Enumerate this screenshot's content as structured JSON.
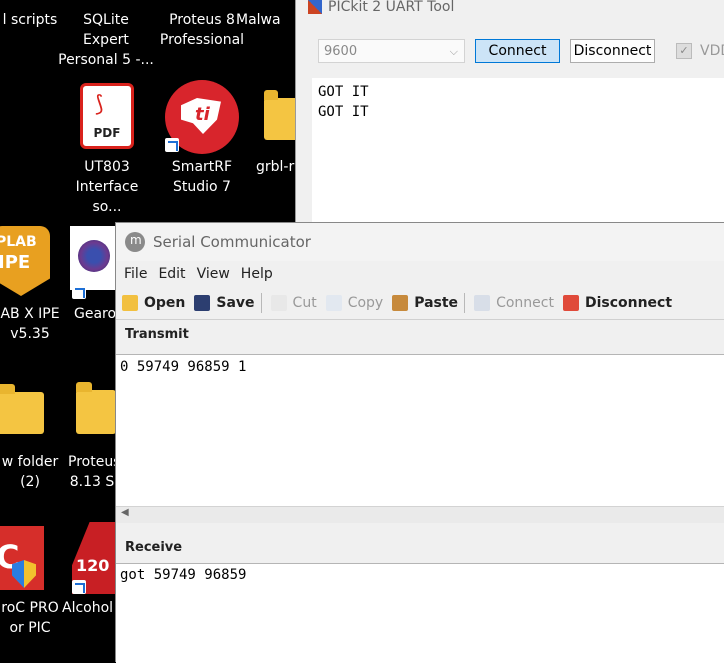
{
  "desktop": {
    "icons": [
      {
        "label": "l scripts"
      },
      {
        "label": "SQLite Expert\nPersonal 5 -..."
      },
      {
        "label": "Proteus 8\nProfessional"
      },
      {
        "label": "Malwa"
      },
      {
        "label": "UT803\nInterface so..."
      },
      {
        "label": "SmartRF\nStudio 7"
      },
      {
        "label": "grbl-r"
      },
      {
        "label": "AB X IPE\nv5.35"
      },
      {
        "label": "Gearo"
      },
      {
        "label": "w folder\n(2)"
      },
      {
        "label": "Proteus\n8.13 S"
      },
      {
        "label": "roC PRO\nor PIC"
      },
      {
        "label": "Alcohol"
      }
    ],
    "pdf_badge": "PDF",
    "plab_badge": "PLAB",
    "ipe_badge": "IPE",
    "alcohol_badge": "120"
  },
  "pickit": {
    "title": "PICkit 2 UART Tool",
    "baud": "9600",
    "connect_label": "Connect",
    "disconnect_label": "Disconnect",
    "vdd_label": "VDD",
    "output": [
      "GOT IT",
      "GOT IT"
    ]
  },
  "serial": {
    "title": "Serial Communicator",
    "menu": [
      "File",
      "Edit",
      "View",
      "Help"
    ],
    "toolbar": {
      "open": "Open",
      "save": "Save",
      "cut": "Cut",
      "copy": "Copy",
      "paste": "Paste",
      "connect": "Connect",
      "disconnect": "Disconnect"
    },
    "transmit_label": "Transmit",
    "transmit_text": "0 59749 96859 1",
    "receive_label": "Receive",
    "receive_text": "got 59749 96859"
  },
  "colors": {
    "connect_accent": "#0078d7",
    "desktop_bg": "#000000"
  }
}
